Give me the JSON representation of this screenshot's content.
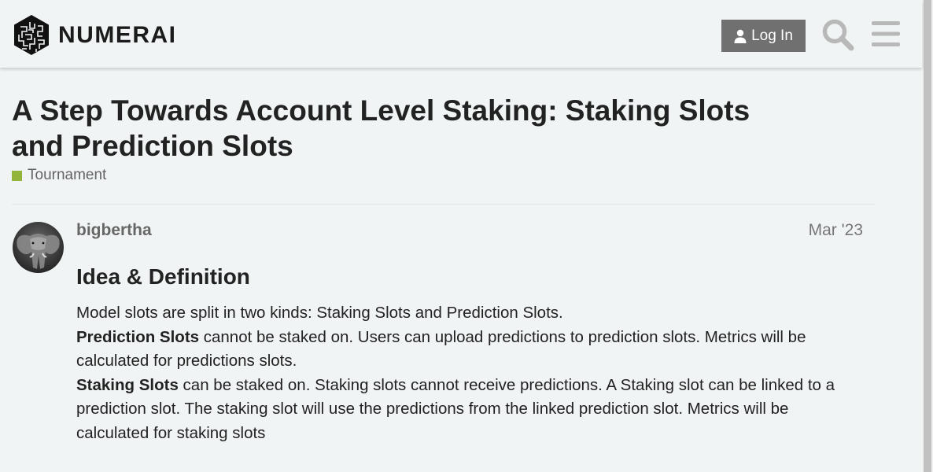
{
  "header": {
    "logo_text": "NUMERAI",
    "login_label": "Log In",
    "icons": {
      "user": "user-icon",
      "search": "search-icon",
      "menu": "hamburger-menu-icon"
    }
  },
  "topic": {
    "title": "A Step Towards Account Level Staking: Staking Slots and Prediction Slots",
    "category": {
      "name": "Tournament",
      "color": "#92b43b"
    }
  },
  "post": {
    "username": "bigbertha",
    "date": "Mar '23",
    "heading": "Idea & Definition",
    "paragraphs": {
      "intro": "Model slots are split in two kinds: Staking Slots and Prediction Slots.",
      "prediction_term": "Prediction Slots",
      "prediction_text": " cannot be staked on. Users can upload predictions to prediction slots. Metrics will be calculated for predictions slots.",
      "staking_term": "Staking Slots",
      "staking_text": " can be staked on. Staking slots cannot receive predictions. A Staking slot can be linked to a prediction slot. The staking slot will use the predictions from the linked prediction slot. Metrics will be calculated for staking slots"
    }
  },
  "colors": {
    "background": "#f1f4f5",
    "login_button": "#707070",
    "icon_gray": "#b8b8b8"
  }
}
